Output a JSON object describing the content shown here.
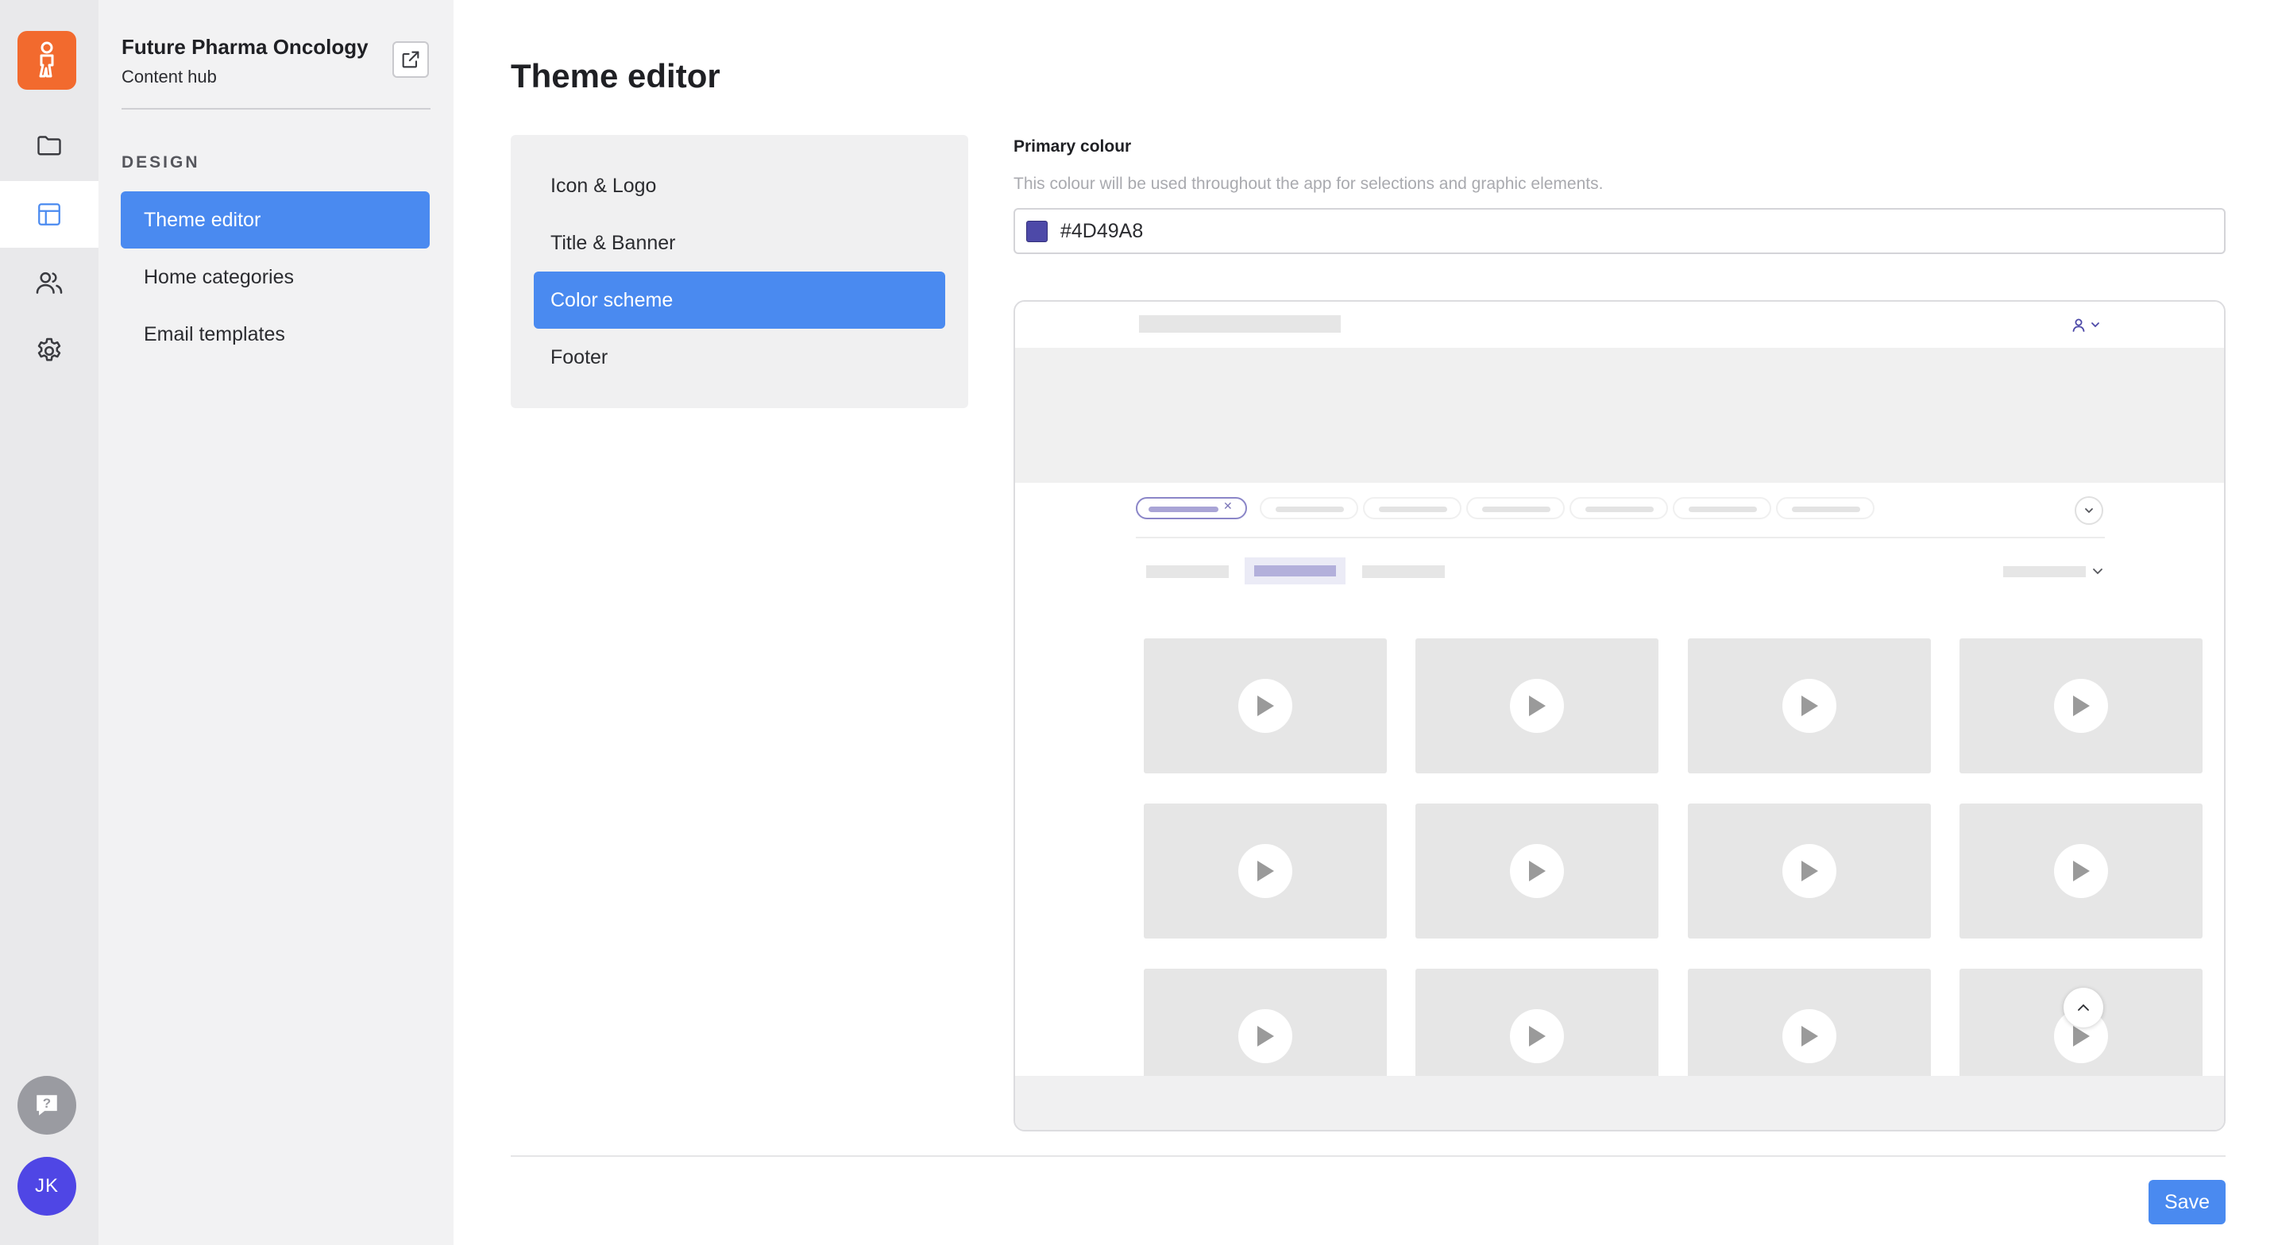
{
  "rail": {
    "items": [
      {
        "name": "folder-icon",
        "active": false
      },
      {
        "name": "layout-icon",
        "active": true
      },
      {
        "name": "users-icon",
        "active": false
      },
      {
        "name": "gear-icon",
        "active": false
      }
    ],
    "avatar_initials": "JK",
    "accent": "#f26a2e"
  },
  "sidebar": {
    "org_name": "Future Pharma Oncology",
    "org_sub": "Content hub",
    "section": "DESIGN",
    "items": [
      {
        "label": "Theme editor",
        "active": true
      },
      {
        "label": "Home categories",
        "active": false
      },
      {
        "label": "Email templates",
        "active": false
      }
    ]
  },
  "main": {
    "title": "Theme editor",
    "subnav": [
      {
        "label": "Icon & Logo",
        "active": false
      },
      {
        "label": "Title & Banner",
        "active": false
      },
      {
        "label": "Color scheme",
        "active": true
      },
      {
        "label": "Footer",
        "active": false
      }
    ],
    "primary_colour": {
      "label": "Primary colour",
      "help": "This colour will be used throughout the app for selections and graphic elements.",
      "value": "#4D49A8"
    },
    "save_label": "Save"
  },
  "colors": {
    "primary_selection": "#4a8af0",
    "theme_primary": "#4D49A8"
  }
}
